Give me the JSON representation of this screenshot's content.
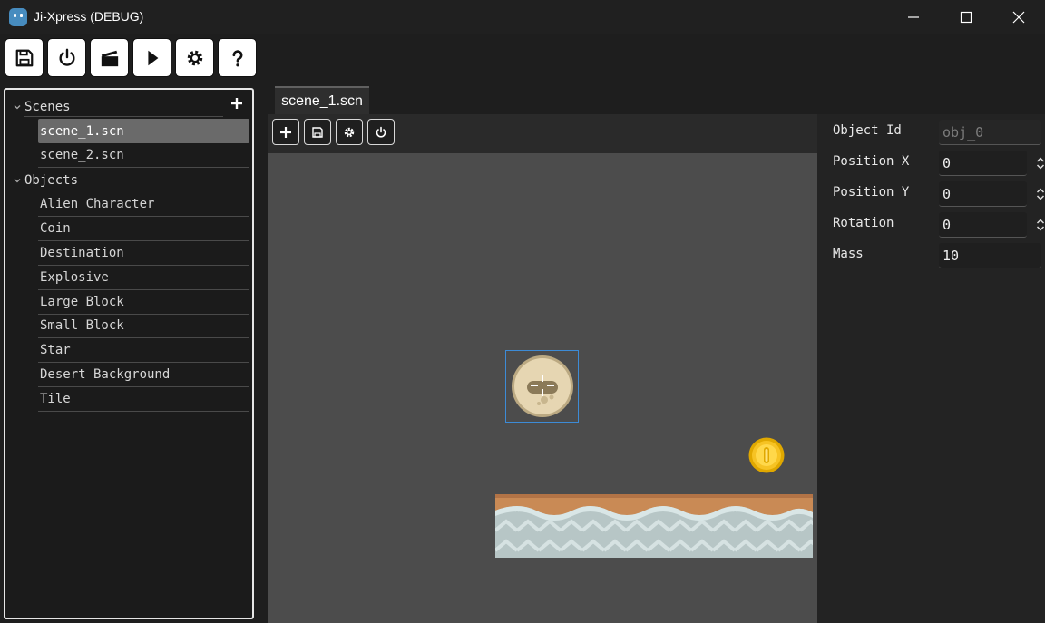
{
  "window": {
    "title": "Ji-Xpress (DEBUG)"
  },
  "toolbar": {
    "buttons": [
      "save-icon",
      "power-icon",
      "clapperboard-icon",
      "play-icon",
      "gear-icon",
      "help-icon"
    ]
  },
  "tree": {
    "scenes_label": "Scenes",
    "scenes": [
      "scene_1.scn",
      "scene_2.scn"
    ],
    "selected_scene": "scene_1.scn",
    "objects_label": "Objects",
    "objects": [
      "Alien Character",
      "Coin",
      "Destination",
      "Explosive",
      "Large Block",
      "Small Block",
      "Star",
      "Desert Background",
      "Tile"
    ]
  },
  "editor": {
    "tab_label": "scene_1.scn",
    "subtools": [
      "plus-icon",
      "save-icon",
      "gear-icon",
      "power-icon"
    ]
  },
  "inspector": {
    "object_id_label": "Object Id",
    "object_id_value": "obj_0",
    "position_x_label": "Position X",
    "position_x_value": "0",
    "position_y_label": "Position Y",
    "position_y_value": "0",
    "rotation_label": "Rotation",
    "rotation_value": "0",
    "mass_label": "Mass",
    "mass_value": "10"
  },
  "colors": {
    "selection": "#3d8bd6",
    "coin": "#f6c324",
    "alien": "#e6d6b2"
  }
}
